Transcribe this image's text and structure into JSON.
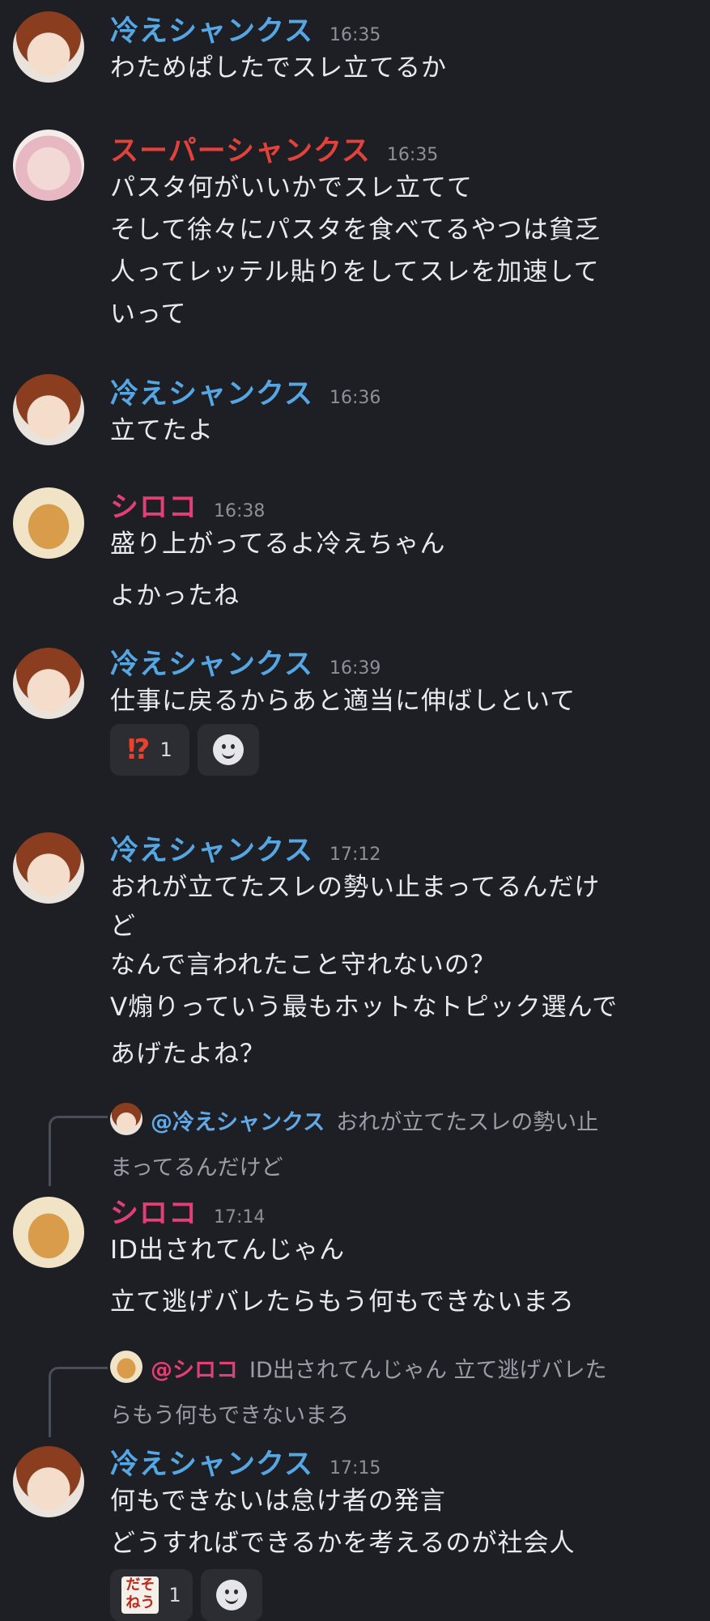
{
  "messages": [
    {
      "author": "冷えシャンクス",
      "time": "16:35",
      "lines": [
        "わためぱしたでスレ立てるか"
      ]
    },
    {
      "author": "スーパーシャンクス",
      "time": "16:35",
      "lines": [
        "パスタ何がいいかでスレ立てて",
        "そして徐々にパスタを食べてるやつは貧乏",
        "人ってレッテル貼りをしてスレを加速して",
        "いって"
      ]
    },
    {
      "author": "冷えシャンクス",
      "time": "16:36",
      "lines": [
        "立てたよ"
      ]
    },
    {
      "author": "シロコ",
      "time": "16:38",
      "lines": [
        "盛り上がってるよ冷えちゃん",
        "よかったね"
      ]
    },
    {
      "author": "冷えシャンクス",
      "time": "16:39",
      "lines": [
        "仕事に戻るからあと適当に伸ばしといて"
      ],
      "reaction": {
        "emoji": "⁉",
        "count": "1"
      }
    },
    {
      "author": "冷えシャンクス",
      "time": "17:12",
      "lines": [
        "おれが立てたスレの勢い止まってるんだけ",
        "ど",
        "なんで言われたこと守れないの？",
        "V煽りっていう最もホットなトピック選んで",
        "あげたよね？"
      ]
    },
    {
      "author": "シロコ",
      "time": "17:14",
      "reply": {
        "mention": "@冷えシャンクス",
        "text": "おれが立てたスレの勢い止",
        "text2": "まってるんだけど"
      },
      "lines": [
        "ID出されてんじゃん",
        "立て逃げバレたらもう何もできないまろ"
      ]
    },
    {
      "author": "冷えシャンクス",
      "time": "17:15",
      "reply": {
        "mention": "@シロコ",
        "text": "ID出されてんじゃん 立て逃げバレた",
        "text2": "らもう何もできないまろ"
      },
      "lines": [
        "何もできないは怠け者の発言",
        "どうすればできるかを考えるのが社会人"
      ],
      "reaction": {
        "stamp": [
          "だそ",
          "ねう"
        ],
        "count": "1"
      }
    }
  ],
  "colors": {
    "background": "#1e1f25",
    "name_blue": "#55a7e4",
    "name_red": "#e3423b",
    "name_pink": "#e23f74",
    "time": "#8d9099"
  },
  "icons": {
    "add_reaction": "smiley-face-icon"
  }
}
